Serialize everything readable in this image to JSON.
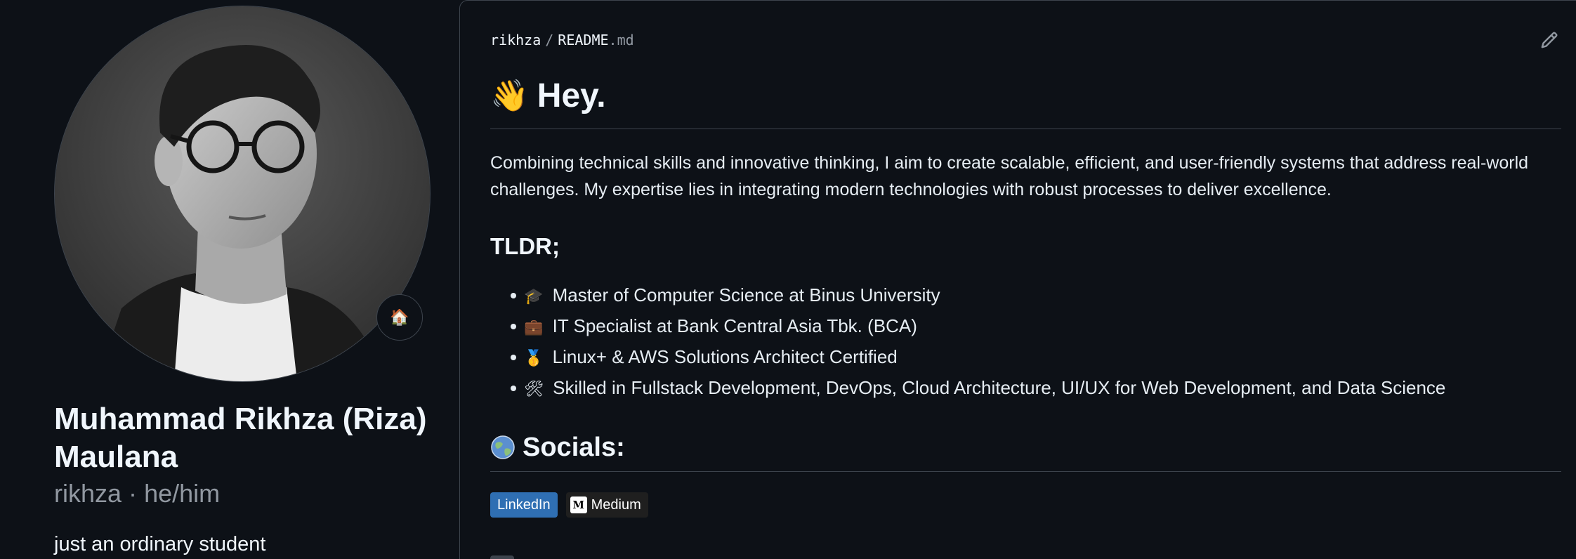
{
  "profile": {
    "name_line1": "Muhammad Rikhza (Riza)",
    "name_line2": "Maulana",
    "username": "rikhza",
    "separator": "·",
    "pronouns": "he/him",
    "bio": "just an ordinary student",
    "status_emoji": "🏠",
    "avatar_icon": "profile-photo"
  },
  "readme": {
    "breadcrumb": {
      "owner": "rikhza",
      "separator": "/",
      "file_name": "README",
      "file_ext": ".md"
    },
    "edit_icon": "pencil-icon",
    "heading": {
      "emoji": "👋",
      "text": "Hey."
    },
    "intro": "Combining technical skills and innovative thinking, I aim to create scalable, efficient, and user-friendly systems that address real-world challenges. My expertise lies in integrating modern technologies with robust processes to deliver excellence.",
    "tldr_heading": "TLDR;",
    "tldr_items": [
      {
        "emoji": "🎓",
        "text": "Master of Computer Science at Binus University"
      },
      {
        "emoji": "💼",
        "text": "IT Specialist at Bank Central Asia Tbk. (BCA)"
      },
      {
        "emoji": "🥇",
        "text": "Linux+ & AWS Solutions Architect Certified"
      },
      {
        "emoji": "🛠",
        "text": "Skilled in Fullstack Development, DevOps, Cloud Architecture, UI/UX for Web Development, and Data Science"
      }
    ],
    "socials_heading": {
      "emoji": "🌐",
      "text": "Socials:"
    },
    "badges": {
      "linkedin": "LinkedIn",
      "medium_logo": "M",
      "medium": "Medium"
    }
  },
  "colors": {
    "background": "#0d1117",
    "border": "#3d444d",
    "muted": "#9198a1",
    "linkedin": "#2f6fb3",
    "medium": "#1f1f1f"
  }
}
